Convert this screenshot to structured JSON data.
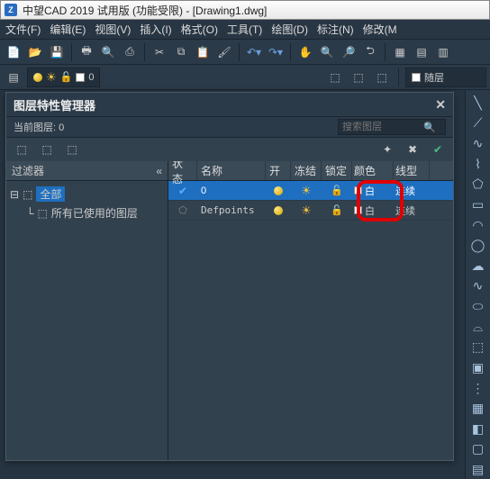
{
  "title": "中望CAD 2019 试用版 (功能受限) - [Drawing1.dwg]",
  "menu": [
    "文件(F)",
    "编辑(E)",
    "视图(V)",
    "插入(I)",
    "格式(O)",
    "工具(T)",
    "绘图(D)",
    "标注(N)",
    "修改(M"
  ],
  "layerbar": {
    "current_color_label": "0",
    "bylayer": "随层"
  },
  "panel": {
    "title": "图层特性管理器",
    "current_label": "当前图层: 0",
    "search_placeholder": "搜索图层",
    "filter_head": "过滤器",
    "tree": {
      "all": "全部",
      "used": "所有已使用的图层"
    },
    "columns": {
      "state": "状态",
      "name": "名称",
      "on": "开",
      "freeze": "冻结",
      "lock": "锁定",
      "color": "颜色",
      "ltype": "线型"
    },
    "rows": [
      {
        "name": "0",
        "color": "白",
        "ltype": "连续",
        "current": true
      },
      {
        "name": "Defpoints",
        "color": "白",
        "ltype": "连续",
        "current": false
      }
    ]
  }
}
